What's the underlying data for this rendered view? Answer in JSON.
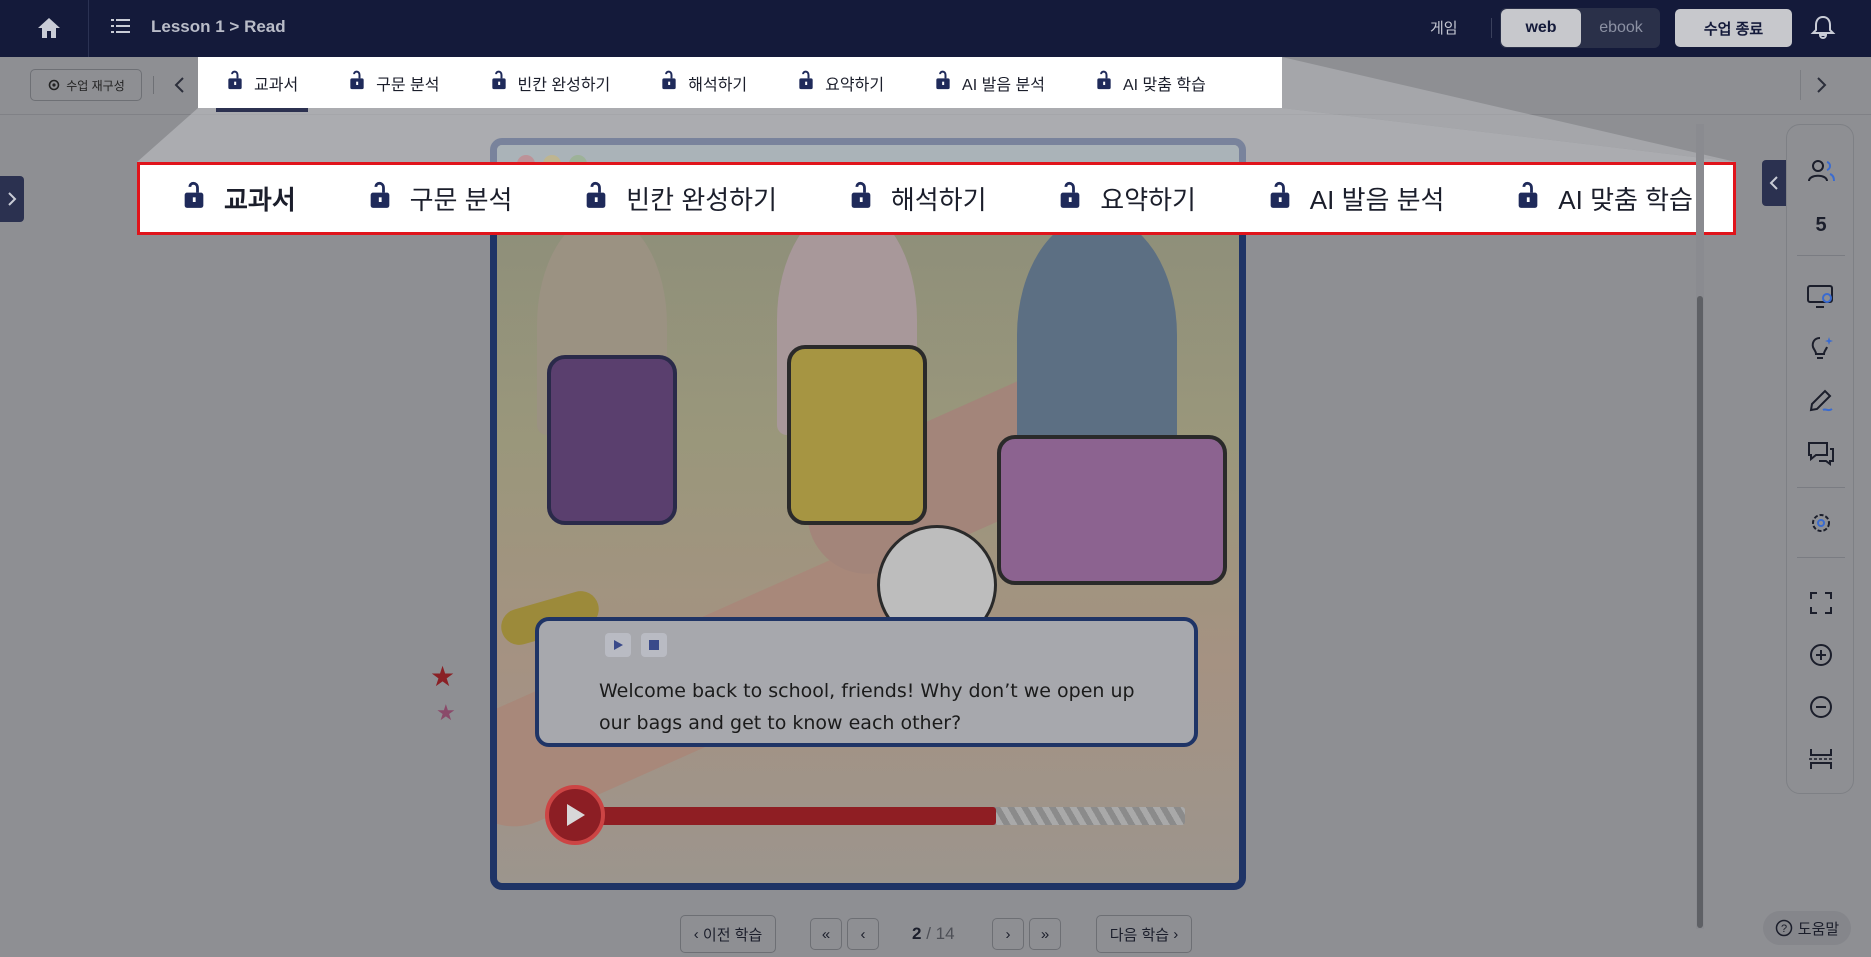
{
  "header": {
    "breadcrumb": "Lesson 1 > Read",
    "game_label": "게임",
    "view_modes": [
      "web",
      "ebook"
    ],
    "active_view": "web",
    "end_class_label": "수업 종료"
  },
  "toolbar": {
    "reconfigure_label": "수업 재구성"
  },
  "tabs": [
    {
      "label": "교과서",
      "active": true,
      "icon": "unlock-icon"
    },
    {
      "label": "구문 분석",
      "active": false,
      "icon": "unlock-icon"
    },
    {
      "label": "빈칸 완성하기",
      "active": false,
      "icon": "unlock-icon"
    },
    {
      "label": "해석하기",
      "active": false,
      "icon": "unlock-icon"
    },
    {
      "label": "요약하기",
      "active": false,
      "icon": "unlock-icon"
    },
    {
      "label": "AI 발음 분석",
      "active": false,
      "icon": "unlock-icon"
    },
    {
      "label": "AI 맞춤 학습",
      "active": false,
      "icon": "unlock-icon"
    }
  ],
  "highlight_color": "#e0141b",
  "content": {
    "dialogue": "Welcome back to school, friends! Why don’t we open up our bags and get to know each other?",
    "audio_progress": 0.68
  },
  "rail": {
    "student_count": "5",
    "icons": [
      "users-icon",
      "monitor-search-icon",
      "lightbulb-icon",
      "pen-icon",
      "chat-icon",
      "settings-icon",
      "fullscreen-icon",
      "zoom-in-icon",
      "zoom-out-icon",
      "fit-width-icon"
    ]
  },
  "pagination": {
    "prev_label": "이전 학습",
    "next_label": "다음 학습",
    "current": "2",
    "separator": "/",
    "total": "14"
  },
  "help_label": "도움말"
}
